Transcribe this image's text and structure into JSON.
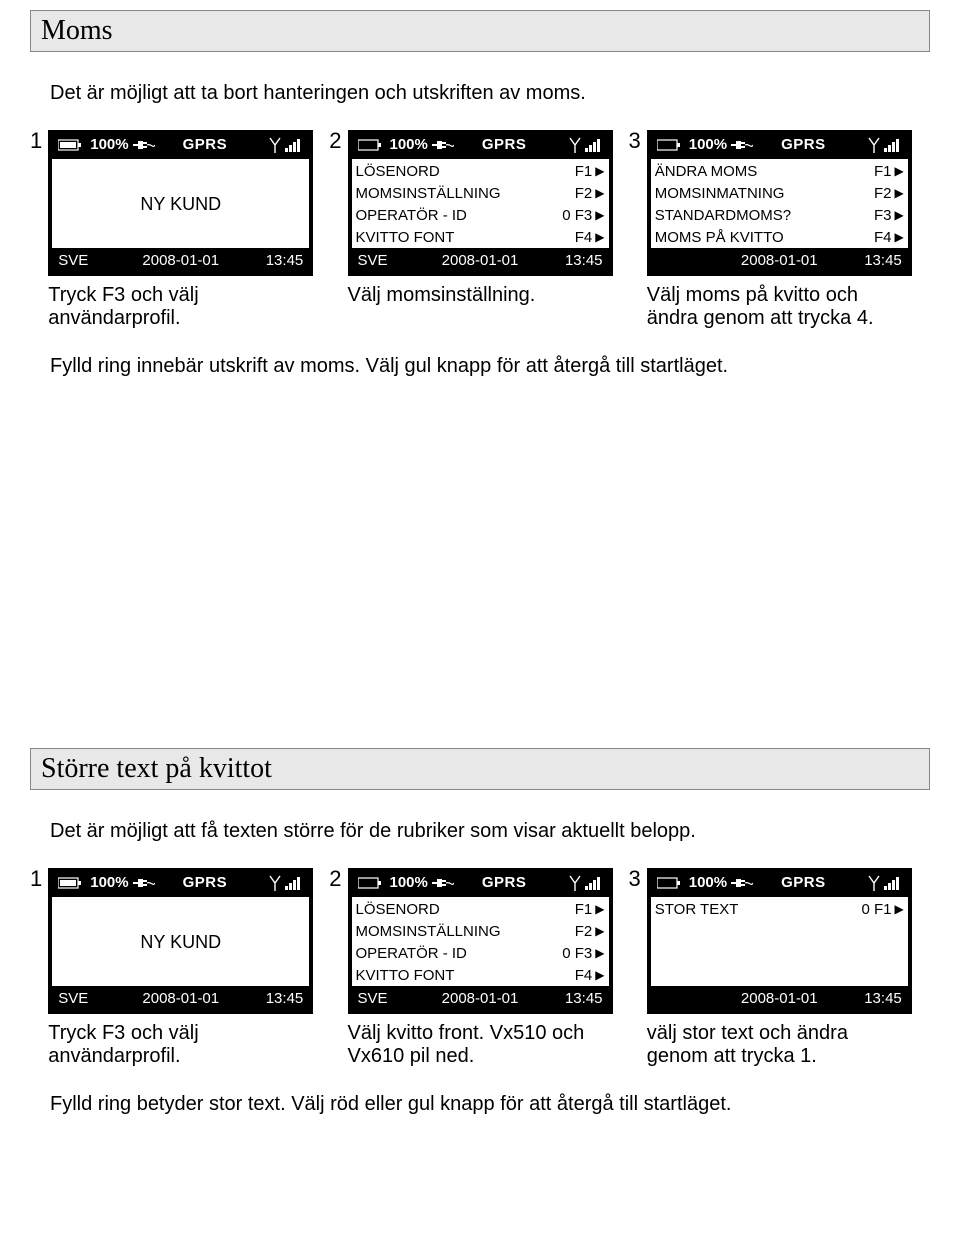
{
  "section1": {
    "header": "Moms",
    "intro": "Det är möjligt att ta bort hanteringen och utskriften av moms.",
    "note": "Fylld ring innebär utskrift av moms. Välj gul knapp för att återgå till startläget."
  },
  "section2": {
    "header": "Större text på kvittot",
    "intro": "Det är möjligt att få texten större för de rubriker som visar aktuellt belopp.",
    "note": "Fylld ring betyder stor text. Välj röd eller gul knapp för att återgå till startläget."
  },
  "status": {
    "pct": "100%",
    "net": "GPRS",
    "lang": "SVE",
    "date": "2008-01-01",
    "time": "13:45"
  },
  "s1": {
    "step1": {
      "num": "1",
      "body": "NY KUND",
      "caption": "Tryck F3 och välj användarprofil."
    },
    "step2": {
      "num": "2",
      "rows": [
        {
          "l": "LÖSENORD",
          "r": "F1"
        },
        {
          "l": "MOMSINSTÄLLNING",
          "r": "F2"
        },
        {
          "l": "OPERATÖR - ID",
          "r": "0 F3"
        },
        {
          "l": "KVITTO FONT",
          "r": "F4"
        }
      ],
      "caption": "Välj momsinställning."
    },
    "step3": {
      "num": "3",
      "rows": [
        {
          "l": "ÄNDRA MOMS",
          "r": "F1"
        },
        {
          "l": "MOMSINMATNING",
          "r": "F2"
        },
        {
          "l": "STANDARDMOMS?",
          "r": "F3"
        },
        {
          "l": "MOMS PÅ KVITTO",
          "r": "F4"
        }
      ],
      "caption": "Välj moms på kvitto och ändra genom att trycka 4."
    }
  },
  "s2": {
    "step1": {
      "num": "1",
      "body": "NY KUND",
      "caption": "Tryck F3 och välj användarprofil."
    },
    "step2": {
      "num": "2",
      "rows": [
        {
          "l": "LÖSENORD",
          "r": "F1"
        },
        {
          "l": "MOMSINSTÄLLNING",
          "r": "F2"
        },
        {
          "l": "OPERATÖR - ID",
          "r": "0 F3"
        },
        {
          "l": "KVITTO FONT",
          "r": "F4"
        }
      ],
      "caption": "Välj kvitto front. Vx510 och Vx610 pil ned."
    },
    "step3": {
      "num": "3",
      "rows": [
        {
          "l": "STOR TEXT",
          "r": "0 F1"
        }
      ],
      "caption": "välj stor text och ändra genom att trycka 1."
    }
  }
}
